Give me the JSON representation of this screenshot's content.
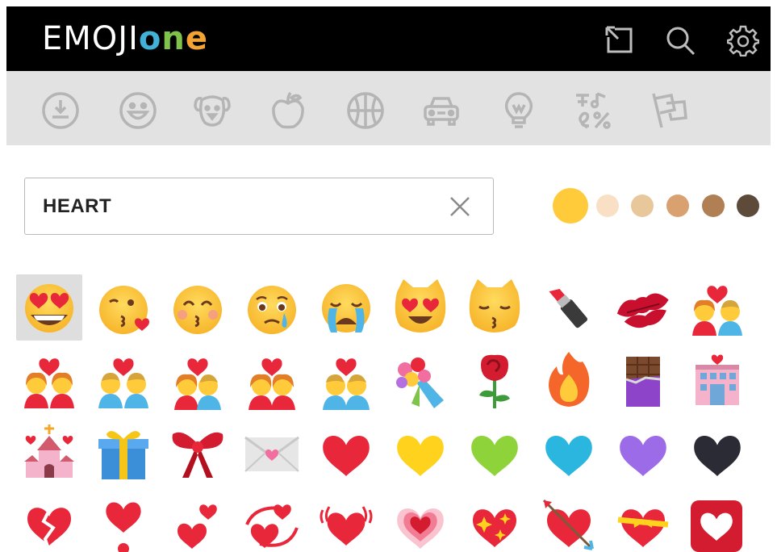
{
  "logo": {
    "part_white": "EMOJI",
    "part_o": "o",
    "part_n": "n",
    "part_e": "e"
  },
  "header_icons": [
    "popout-icon",
    "search-icon",
    "gear-icon"
  ],
  "categories": [
    "recent-clock-icon",
    "smiley-icon",
    "dog-icon",
    "apple-icon",
    "basketball-icon",
    "car-icon",
    "lightbulb-icon",
    "symbols-icon",
    "flags-icon"
  ],
  "search": {
    "value": "HEART",
    "clear_icon": "clear-x-icon"
  },
  "skin_tones": {
    "selected": "yellow",
    "colors": [
      "#FFCB3A",
      "#F9E0C5",
      "#E8C79B",
      "#D9A070",
      "#B07F54",
      "#5E4A38"
    ]
  },
  "emoji_grid": {
    "selected_index": 0,
    "rows": [
      [
        "heart-eyes-face",
        "kissing-heart-face",
        "kissing-smiling-eyes-face",
        "crying-face",
        "loudly-crying-face",
        "heart-eyes-cat",
        "kissing-cat",
        "lipstick",
        "kiss-mark",
        "couple-with-heart"
      ],
      [
        "couple-with-heart-woman-woman",
        "couple-with-heart-man-man",
        "kiss-couple",
        "kiss-woman-woman",
        "kiss-man-man",
        "bouquet",
        "rose",
        "fire",
        "chocolate-bar",
        "love-hotel"
      ],
      [
        "wedding-chapel",
        "wrapped-gift",
        "ribbon",
        "love-letter",
        "red-heart",
        "yellow-heart",
        "green-heart",
        "blue-heart",
        "purple-heart",
        "black-heart"
      ],
      [
        "broken-heart",
        "heart-exclamation",
        "two-hearts",
        "revolving-hearts",
        "beating-heart",
        "growing-heart",
        "sparkling-heart",
        "heart-with-arrow",
        "heart-with-ribbon",
        "heart-decoration"
      ]
    ]
  }
}
